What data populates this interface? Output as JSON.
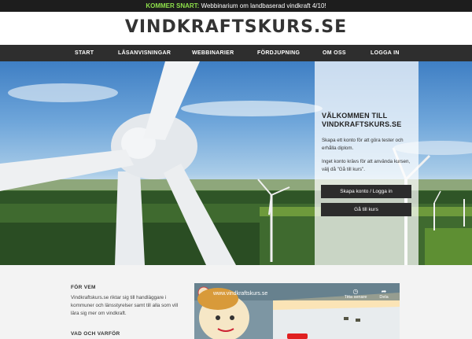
{
  "announcement": {
    "highlight": "KOMMER SNART:",
    "text": "Webbinarium om landbaserad vindkraft 4/10!"
  },
  "site": {
    "logo": "VINDKRAFTSKURS.SE"
  },
  "nav": {
    "items": [
      "START",
      "LÄSANVISNINGAR",
      "WEBBINARIER",
      "FÖRDJUPNING",
      "OM OSS",
      "LOGGA IN"
    ]
  },
  "hero": {
    "title": "VÄLKOMMEN TILL VINDKRAFTSKURS.SE",
    "p1": "Skapa ett konto för att göra tester och erhålla diplom.",
    "p2": "Inget konto krävs för att använda kursen, välj då \"Gå till kurs\".",
    "btn_primary": "Skapa konto / Logga in",
    "btn_secondary": "Gå till kurs"
  },
  "info": {
    "heading1": "FÖR VEM",
    "text1": "Vindkraftskurs.se riktar sig till handläggare i kommuner och länsstyrelser samt till alla som vill lära sig mer om vindkraft.",
    "heading2": "VAD OCH VARFÖR"
  },
  "video": {
    "title": "www.vindkraftskurs.se",
    "watch_later": "Titta senare",
    "share": "Dela",
    "watch_later_icon": "clock-icon",
    "share_icon": "share-icon"
  }
}
